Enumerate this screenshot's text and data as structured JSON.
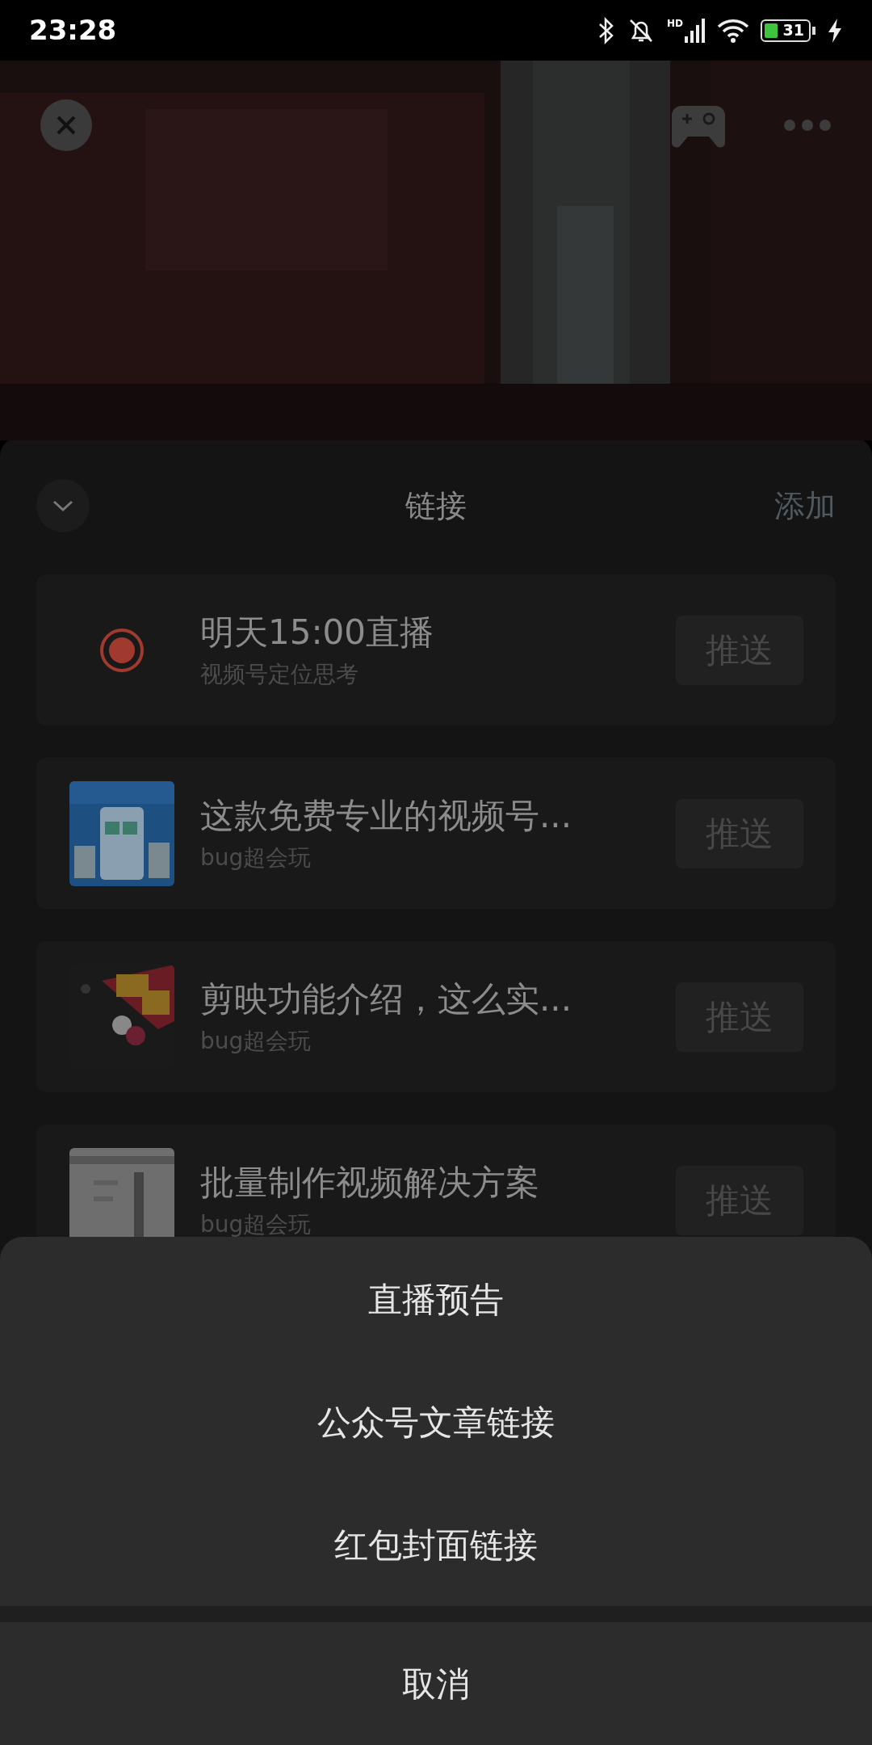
{
  "status_bar": {
    "time": "23:28",
    "network_label": "HD",
    "battery": "31"
  },
  "panel": {
    "title": "链接",
    "action": "添加"
  },
  "links": [
    {
      "kind": "live",
      "title": "明天15:00直播",
      "subtitle": "视频号定位思考",
      "button": "推送"
    },
    {
      "kind": "article",
      "title": "这款免费专业的视频号...",
      "subtitle": "bug超会玩",
      "button": "推送"
    },
    {
      "kind": "article",
      "title": "剪映功能介绍，这么实...",
      "subtitle": "bug超会玩",
      "button": "推送"
    },
    {
      "kind": "article",
      "title": "批量制作视频解决方案",
      "subtitle": "bug超会玩",
      "button": "推送"
    }
  ],
  "action_sheet": {
    "options": [
      "直播预告",
      "公众号文章链接",
      "红包封面链接"
    ],
    "cancel": "取消"
  }
}
